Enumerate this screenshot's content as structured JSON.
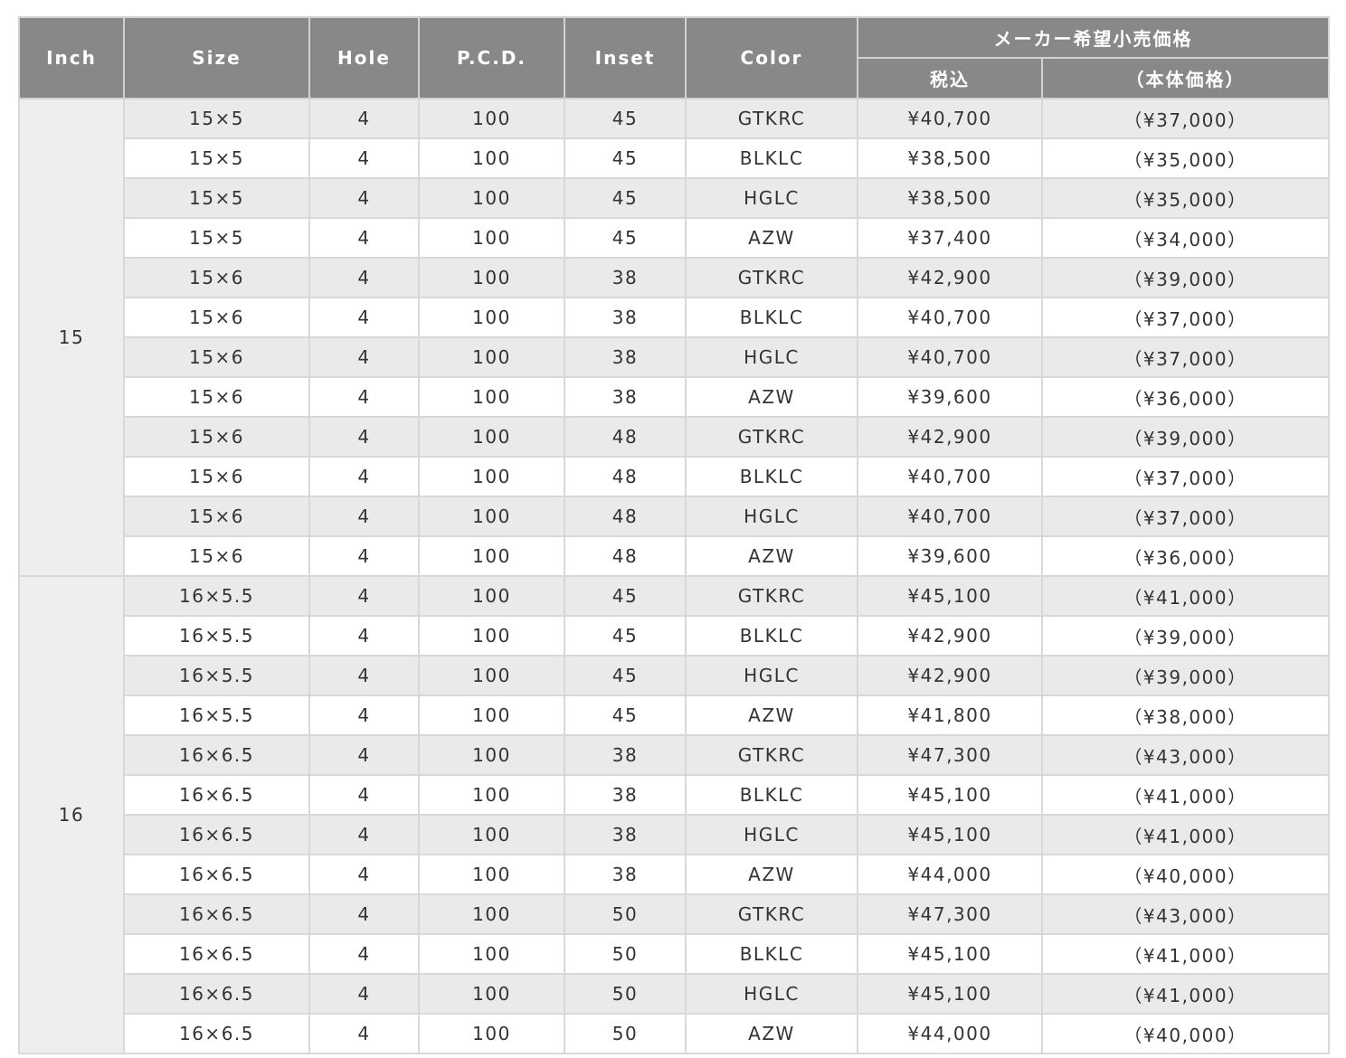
{
  "headers": {
    "inch": "Inch",
    "size": "Size",
    "hole": "Hole",
    "pcd": "P.C.D.",
    "inset": "Inset",
    "color": "Color",
    "price_group": "メーカー希望小売価格",
    "tax_incl": "税込",
    "base_price": "（本体価格）"
  },
  "groups": [
    {
      "inch": "15",
      "rows": [
        {
          "size": "15×5",
          "hole": "4",
          "pcd": "100",
          "inset": "45",
          "color": "GTKRC",
          "tax": "¥40,700",
          "base": "（¥37,000）"
        },
        {
          "size": "15×5",
          "hole": "4",
          "pcd": "100",
          "inset": "45",
          "color": "BLKLC",
          "tax": "¥38,500",
          "base": "（¥35,000）"
        },
        {
          "size": "15×5",
          "hole": "4",
          "pcd": "100",
          "inset": "45",
          "color": "HGLC",
          "tax": "¥38,500",
          "base": "（¥35,000）"
        },
        {
          "size": "15×5",
          "hole": "4",
          "pcd": "100",
          "inset": "45",
          "color": "AZW",
          "tax": "¥37,400",
          "base": "（¥34,000）"
        },
        {
          "size": "15×6",
          "hole": "4",
          "pcd": "100",
          "inset": "38",
          "color": "GTKRC",
          "tax": "¥42,900",
          "base": "（¥39,000）"
        },
        {
          "size": "15×6",
          "hole": "4",
          "pcd": "100",
          "inset": "38",
          "color": "BLKLC",
          "tax": "¥40,700",
          "base": "（¥37,000）"
        },
        {
          "size": "15×6",
          "hole": "4",
          "pcd": "100",
          "inset": "38",
          "color": "HGLC",
          "tax": "¥40,700",
          "base": "（¥37,000）"
        },
        {
          "size": "15×6",
          "hole": "4",
          "pcd": "100",
          "inset": "38",
          "color": "AZW",
          "tax": "¥39,600",
          "base": "（¥36,000）"
        },
        {
          "size": "15×6",
          "hole": "4",
          "pcd": "100",
          "inset": "48",
          "color": "GTKRC",
          "tax": "¥42,900",
          "base": "（¥39,000）"
        },
        {
          "size": "15×6",
          "hole": "4",
          "pcd": "100",
          "inset": "48",
          "color": "BLKLC",
          "tax": "¥40,700",
          "base": "（¥37,000）"
        },
        {
          "size": "15×6",
          "hole": "4",
          "pcd": "100",
          "inset": "48",
          "color": "HGLC",
          "tax": "¥40,700",
          "base": "（¥37,000）"
        },
        {
          "size": "15×6",
          "hole": "4",
          "pcd": "100",
          "inset": "48",
          "color": "AZW",
          "tax": "¥39,600",
          "base": "（¥36,000）"
        }
      ]
    },
    {
      "inch": "16",
      "rows": [
        {
          "size": "16×5.5",
          "hole": "4",
          "pcd": "100",
          "inset": "45",
          "color": "GTKRC",
          "tax": "¥45,100",
          "base": "（¥41,000）"
        },
        {
          "size": "16×5.5",
          "hole": "4",
          "pcd": "100",
          "inset": "45",
          "color": "BLKLC",
          "tax": "¥42,900",
          "base": "（¥39,000）"
        },
        {
          "size": "16×5.5",
          "hole": "4",
          "pcd": "100",
          "inset": "45",
          "color": "HGLC",
          "tax": "¥42,900",
          "base": "（¥39,000）"
        },
        {
          "size": "16×5.5",
          "hole": "4",
          "pcd": "100",
          "inset": "45",
          "color": "AZW",
          "tax": "¥41,800",
          "base": "（¥38,000）"
        },
        {
          "size": "16×6.5",
          "hole": "4",
          "pcd": "100",
          "inset": "38",
          "color": "GTKRC",
          "tax": "¥47,300",
          "base": "（¥43,000）"
        },
        {
          "size": "16×6.5",
          "hole": "4",
          "pcd": "100",
          "inset": "38",
          "color": "BLKLC",
          "tax": "¥45,100",
          "base": "（¥41,000）"
        },
        {
          "size": "16×6.5",
          "hole": "4",
          "pcd": "100",
          "inset": "38",
          "color": "HGLC",
          "tax": "¥45,100",
          "base": "（¥41,000）"
        },
        {
          "size": "16×6.5",
          "hole": "4",
          "pcd": "100",
          "inset": "38",
          "color": "AZW",
          "tax": "¥44,000",
          "base": "（¥40,000）"
        },
        {
          "size": "16×6.5",
          "hole": "4",
          "pcd": "100",
          "inset": "50",
          "color": "GTKRC",
          "tax": "¥47,300",
          "base": "（¥43,000）"
        },
        {
          "size": "16×6.5",
          "hole": "4",
          "pcd": "100",
          "inset": "50",
          "color": "BLKLC",
          "tax": "¥45,100",
          "base": "（¥41,000）"
        },
        {
          "size": "16×6.5",
          "hole": "4",
          "pcd": "100",
          "inset": "50",
          "color": "HGLC",
          "tax": "¥45,100",
          "base": "（¥41,000）"
        },
        {
          "size": "16×6.5",
          "hole": "4",
          "pcd": "100",
          "inset": "50",
          "color": "AZW",
          "tax": "¥44,000",
          "base": "（¥40,000）"
        }
      ]
    }
  ]
}
